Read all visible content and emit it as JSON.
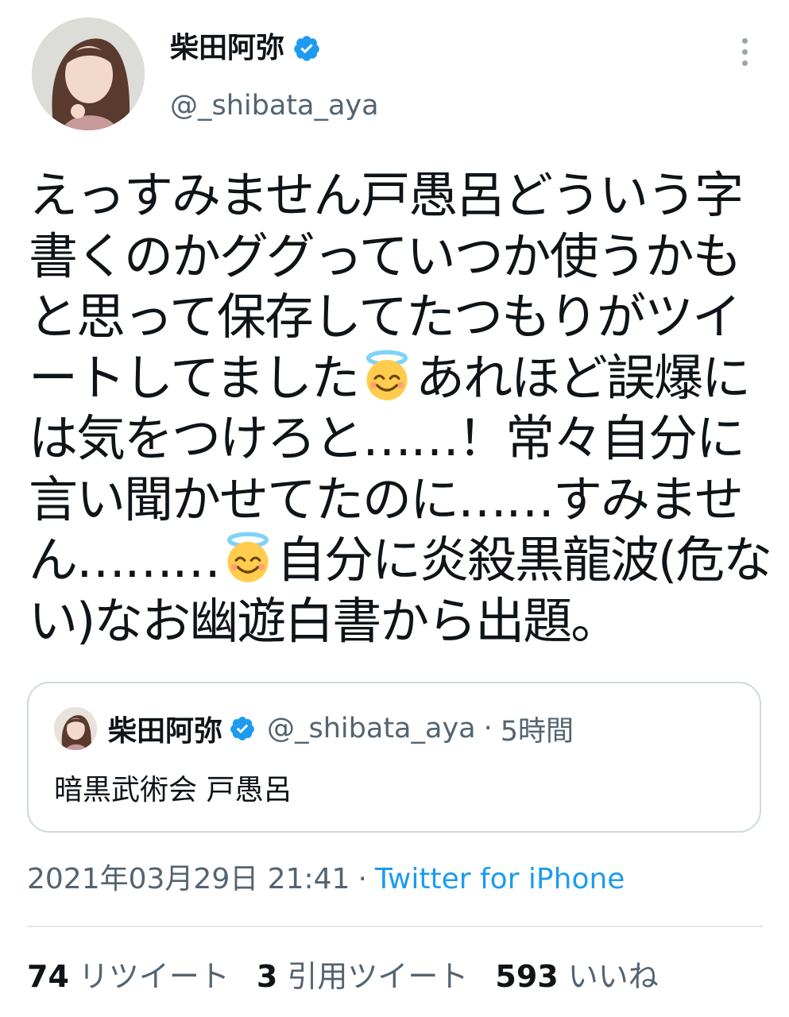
{
  "author": {
    "display_name": "柴田阿弥",
    "handle": "@_shibata_aya",
    "verified": true
  },
  "icons": {
    "more": "more-vertical-icon",
    "verified": "verified-badge-icon",
    "emoji": "smiling-face-with-halo-emoji"
  },
  "tweet": {
    "lines": [
      "えっすみません戸愚呂どういう字",
      "書くのかググっていつか使うかも",
      "と思って保存してたつもりがツイ",
      {
        "before": "ートしてました",
        "after": "あれほど誤爆に"
      },
      "は気をつけろと……！常々自分に",
      "言い聞かせてたのに……すみませ",
      {
        "before": "ん………",
        "after": "自分に炎殺黒龍波(危な"
      },
      "い)なお幽遊白書から出題。"
    ]
  },
  "quote": {
    "display_name": "柴田阿弥",
    "handle": "@_shibata_aya",
    "separator": "·",
    "time": "5時間",
    "text": "暗黒武術会 戸愚呂"
  },
  "meta": {
    "date": "2021年03月29日 21:41",
    "separator": "·",
    "source": "Twitter for iPhone"
  },
  "stats": {
    "retweets": {
      "count": "74",
      "label": "リツイート"
    },
    "quotes": {
      "count": "3",
      "label": "引用ツイート"
    },
    "likes": {
      "count": "593",
      "label": "いいね"
    }
  },
  "colors": {
    "text": "#0f1419",
    "secondary": "#536471",
    "link": "#1d9bf0",
    "border": "#cfd9de"
  }
}
